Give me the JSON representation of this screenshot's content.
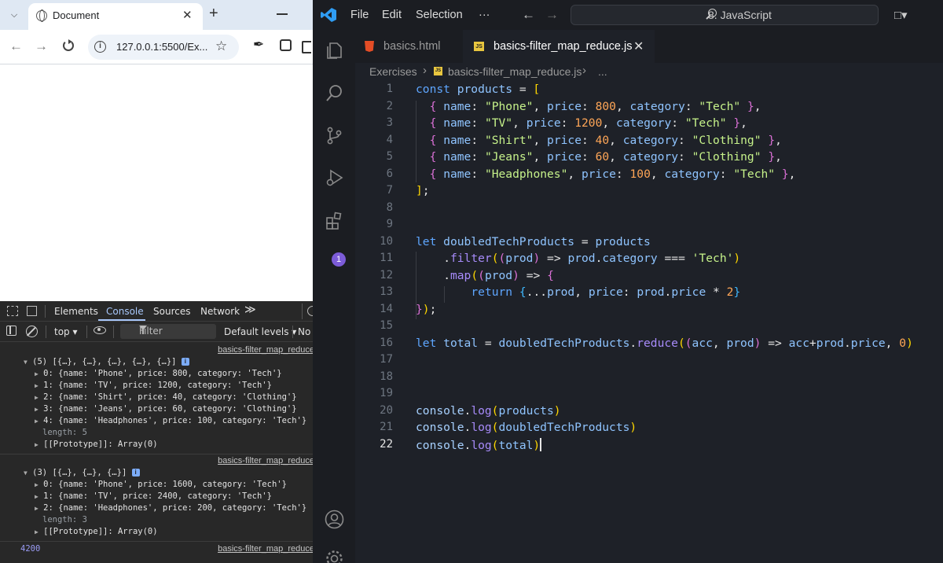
{
  "browser": {
    "tab_title": "Document",
    "url": "127.0.0.1:5500/Ex..."
  },
  "devtools": {
    "tabs": [
      "Elements",
      "Console",
      "Sources",
      "Network"
    ],
    "more_tabs": "≫",
    "context": "top ▾",
    "filter_placeholder": "Filter",
    "levels": "Default levels ▾",
    "no_issues": "No",
    "source_link": "basics-filter_map_reduce",
    "log1": {
      "summary": "(5) [{…}, {…}, {…}, {…}, {…}]",
      "items": [
        "0: {name: 'Phone', price: 800, category: 'Tech'}",
        "1: {name: 'TV', price: 1200, category: 'Tech'}",
        "2: {name: 'Shirt', price: 40, category: 'Clothing'}",
        "3: {name: 'Jeans', price: 60, category: 'Clothing'}",
        "4: {name: 'Headphones', price: 100, category: 'Tech'}"
      ],
      "length": "length: 5",
      "proto": "[[Prototype]]: Array(0)"
    },
    "log2": {
      "summary": "(3) [{…}, {…}, {…}]",
      "items": [
        "0: {name: 'Phone', price: 1600, category: 'Tech'}",
        "1: {name: 'TV', price: 2400, category: 'Tech'}",
        "2: {name: 'Headphones', price: 200, category: 'Tech'}"
      ],
      "length": "length: 3",
      "proto": "[[Prototype]]: Array(0)"
    },
    "log3": {
      "value": "4200"
    }
  },
  "vscode": {
    "menu": [
      "File",
      "Edit",
      "Selection",
      "···"
    ],
    "command_center": "8. JavaScript",
    "tabs": [
      {
        "label": "basics.html",
        "active": false,
        "icon": "html-icon"
      },
      {
        "label": "basics-filter_map_reduce.js",
        "active": true,
        "icon": "js-icon"
      }
    ],
    "breadcrumb": [
      "Exercises",
      "basics-filter_map_reduce.js",
      "..."
    ],
    "activity_badge": "1",
    "current_line": 22,
    "code_lines": [
      "const products = [",
      "  { name: \"Phone\", price: 800, category: \"Tech\" },",
      "  { name: \"TV\", price: 1200, category: \"Tech\" },",
      "  { name: \"Shirt\", price: 40, category: \"Clothing\" },",
      "  { name: \"Jeans\", price: 60, category: \"Clothing\" },",
      "  { name: \"Headphones\", price: 100, category: \"Tech\" },",
      "];",
      "",
      "",
      "let doubledTechProducts = products",
      "    .filter((prod) => prod.category === 'Tech')",
      "    .map((prod) => {",
      "        return {...prod, price: prod.price * 2}",
      "});",
      "",
      "let total = doubledTechProducts.reduce((acc, prod) => acc+prod.price, 0)",
      "",
      "",
      "",
      "console.log(products)",
      "console.log(doubledTechProducts)",
      "console.log(total)"
    ]
  }
}
